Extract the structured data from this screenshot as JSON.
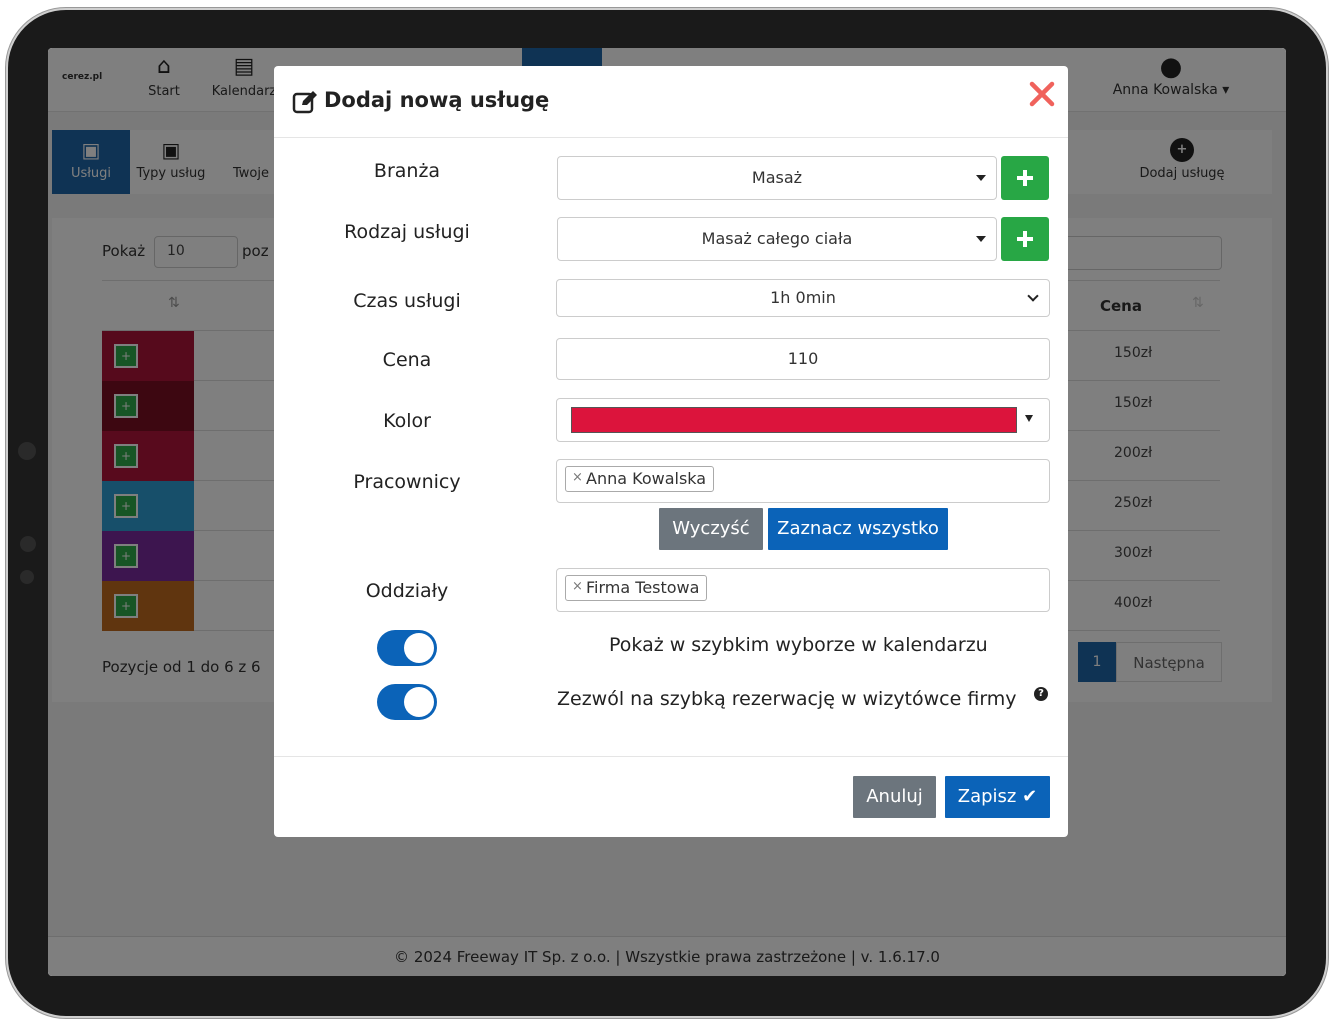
{
  "app": {
    "logo": "cerez.pl",
    "nav": [
      {
        "label": "Start",
        "icon": "home-icon"
      },
      {
        "label": "Kalendarz",
        "icon": "calendar-icon"
      }
    ],
    "user": {
      "name": "Anna Kowalska",
      "icon": "user-icon"
    },
    "sub_nav": [
      {
        "label": "Usługi",
        "icon": "briefcase-icon"
      },
      {
        "label": "Typy usług",
        "icon": "briefcase-icon"
      },
      {
        "label": "Twoje",
        "icon": ""
      }
    ],
    "add_service_label": "Dodaj usługę",
    "table": {
      "show_label": "Pokaż",
      "show_value": "10",
      "pos_label_partial": "poz",
      "header_price": "Cena",
      "rows": [
        {
          "color": "#ad1438",
          "price": "150zł"
        },
        {
          "color": "#7a0f22",
          "price": "150zł"
        },
        {
          "color": "#b0143a",
          "price": "200zł"
        },
        {
          "color": "#2e9fd4",
          "price": "250zł"
        },
        {
          "color": "#7a2a9e",
          "price": "300zł"
        },
        {
          "color": "#c06a1e",
          "price": "400zł"
        }
      ],
      "summary": "Pozycje od 1 do 6 z 6",
      "page": "1",
      "next": "Następna"
    },
    "footer": "© 2024 Freeway IT Sp. z o.o.  |  Wszystkie prawa zastrzeżone  |  v. 1.6.17.0"
  },
  "modal": {
    "title": "Dodaj nową usługę",
    "fields": {
      "branza_label": "Branża",
      "branza_value": "Masaż",
      "rodzaj_label": "Rodzaj usługi",
      "rodzaj_value": "Masaż całego ciała",
      "czas_label": "Czas usługi",
      "czas_value": "1h 0min",
      "cena_label": "Cena",
      "cena_value": "110",
      "kolor_label": "Kolor",
      "kolor_value": "#dc143c",
      "pracownicy_label": "Pracownicy",
      "pracownicy_tag": "Anna Kowalska",
      "oddzialy_label": "Oddziały",
      "oddzialy_tag": "Firma Testowa"
    },
    "clear_button": "Wyczyść",
    "select_all_button": "Zaznacz wszystko",
    "toggle1_label": "Pokaż w szybkim wyborze w kalendarzu",
    "toggle2_label": "Zezwól na szybką rezerwację w wizytówce firmy",
    "cancel_button": "Anuluj",
    "save_button": "Zapisz"
  }
}
